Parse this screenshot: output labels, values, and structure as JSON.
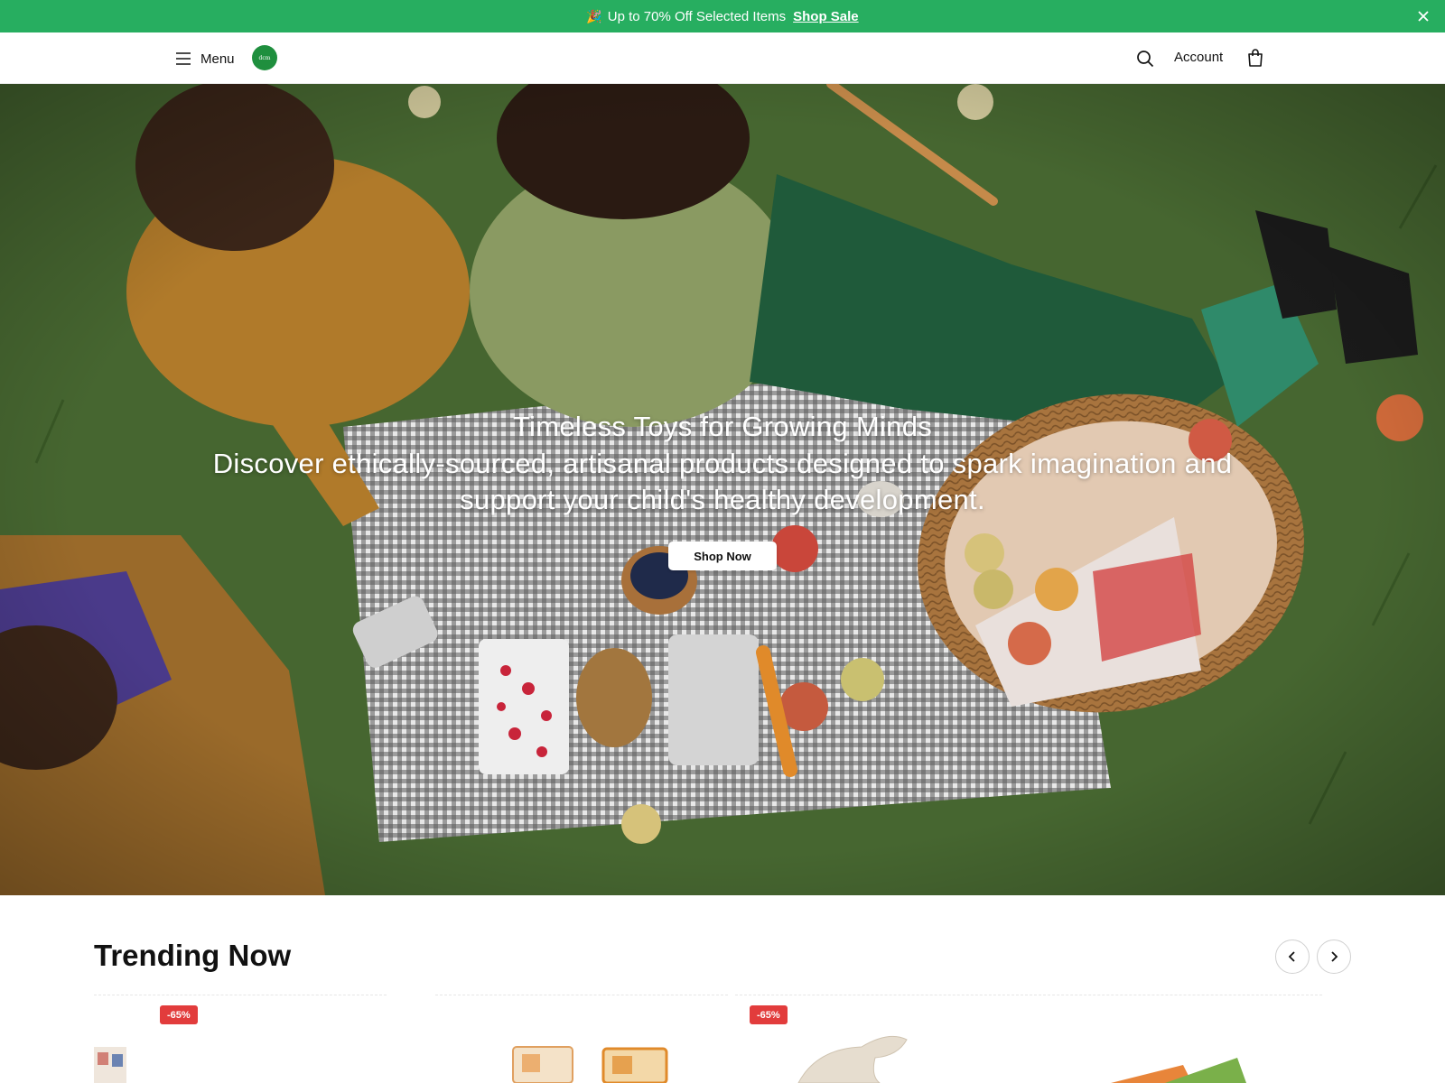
{
  "announcement": {
    "emoji": "🎉",
    "text": "Up to 70% Off Selected Items",
    "link_label": "Shop Sale"
  },
  "header": {
    "menu_label": "Menu",
    "logo_text": "dcm",
    "account_label": "Account"
  },
  "hero": {
    "title": "Timeless Toys for Growing Minds",
    "subtitle": "Discover ethically-sourced, artisanal products designed to spark imagination and support your child's healthy development.",
    "cta_label": "Shop Now"
  },
  "trending": {
    "title": "Trending Now",
    "products": [
      {
        "badge": "-65%",
        "thumb": "alphabet-blocks"
      },
      {
        "badge": "",
        "thumb": "wooden-blocks"
      },
      {
        "badge": "-65%",
        "thumb": "ceramic-bird"
      },
      {
        "badge": "",
        "thumb": "book-set"
      }
    ]
  },
  "colors": {
    "accent": "#27ae60",
    "badge": "#e23c3c",
    "text": "#111111"
  }
}
